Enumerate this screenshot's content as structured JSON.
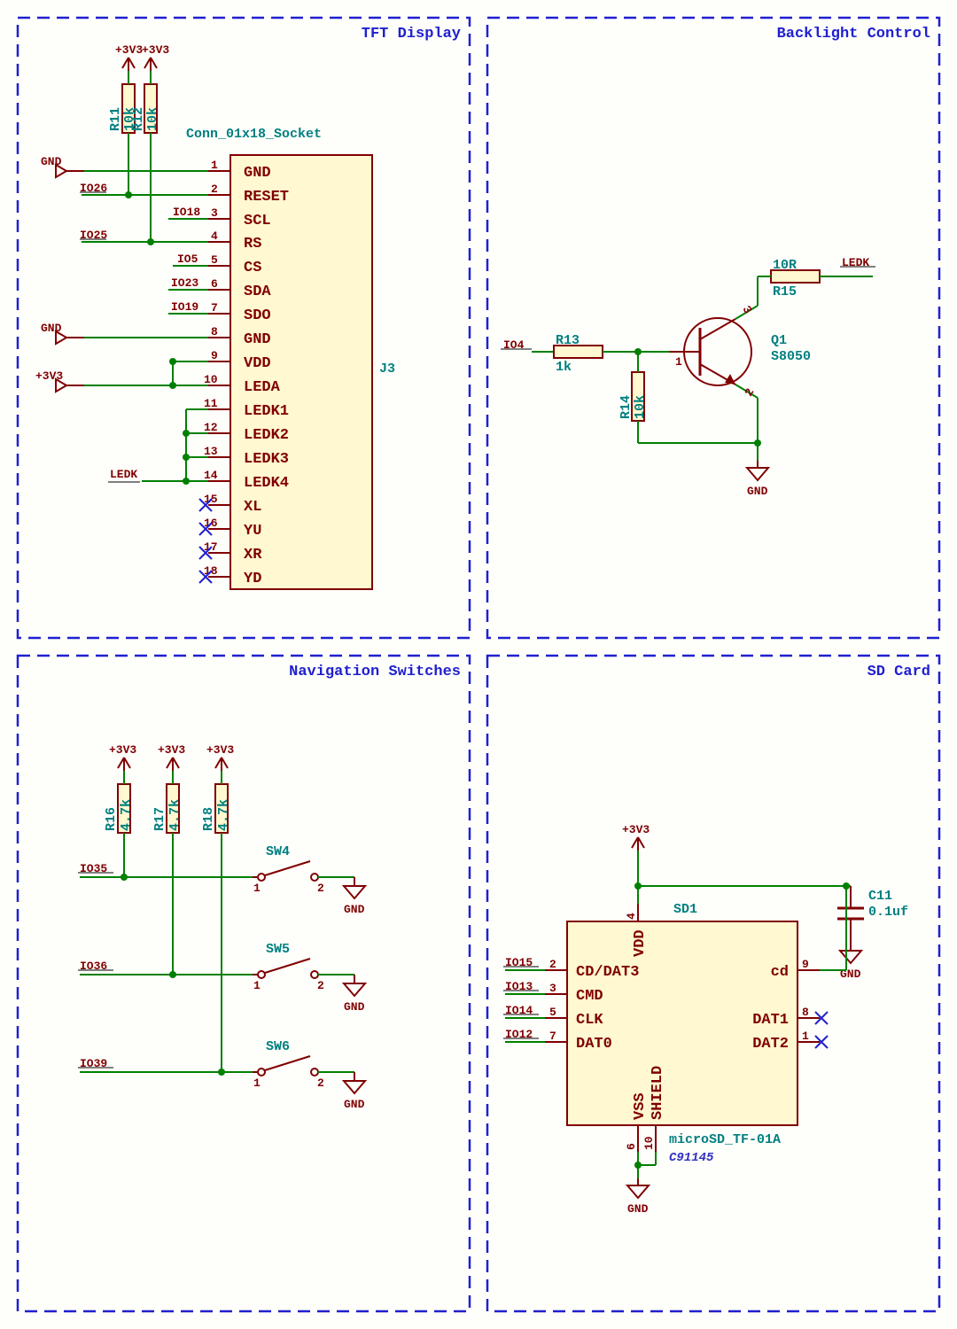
{
  "blocks": {
    "tft": {
      "title": "TFT Display"
    },
    "bl": {
      "title": "Backlight Control"
    },
    "nav": {
      "title": "Navigation Switches"
    },
    "sd": {
      "title": "SD Card"
    }
  },
  "tft": {
    "conn_label": "Conn_01x18_Socket",
    "ref": "J3",
    "r11": {
      "ref": "R11",
      "val": "10k"
    },
    "r12": {
      "ref": "R12",
      "val": "10k"
    },
    "pwr1": "+3V3",
    "pwr2": "+3V3",
    "gnd_top": "GND",
    "gnd_mid": "GND",
    "v33": "+3V3",
    "ledk": "LEDK",
    "nets": {
      "io26": "IO26",
      "io18": "IO18",
      "io25": "IO25",
      "io5": "IO5",
      "io23": "IO23",
      "io19": "IO19"
    },
    "pins": [
      {
        "n": "1",
        "name": "GND"
      },
      {
        "n": "2",
        "name": "RESET"
      },
      {
        "n": "3",
        "name": "SCL"
      },
      {
        "n": "4",
        "name": "RS"
      },
      {
        "n": "5",
        "name": "CS"
      },
      {
        "n": "6",
        "name": "SDA"
      },
      {
        "n": "7",
        "name": "SDO"
      },
      {
        "n": "8",
        "name": "GND"
      },
      {
        "n": "9",
        "name": "VDD"
      },
      {
        "n": "10",
        "name": "LEDA"
      },
      {
        "n": "11",
        "name": "LEDK1"
      },
      {
        "n": "12",
        "name": "LEDK2"
      },
      {
        "n": "13",
        "name": "LEDK3"
      },
      {
        "n": "14",
        "name": "LEDK4"
      },
      {
        "n": "15",
        "name": "XL"
      },
      {
        "n": "16",
        "name": "YU"
      },
      {
        "n": "17",
        "name": "XR"
      },
      {
        "n": "18",
        "name": "YD"
      }
    ]
  },
  "bl": {
    "io4": "IO4",
    "ledk": "LEDK",
    "gnd": "GND",
    "r13": {
      "ref": "R13",
      "val": "1k"
    },
    "r14": {
      "ref": "R14",
      "val": "10k"
    },
    "r15": {
      "ref": "R15",
      "val": "10R"
    },
    "q1": {
      "ref": "Q1",
      "val": "S8050"
    },
    "q1_pins": {
      "b": "1",
      "e": "2",
      "c": "3"
    }
  },
  "nav": {
    "pwr": "+3V3",
    "r16": {
      "ref": "R16",
      "val": "4.7k"
    },
    "r17": {
      "ref": "R17",
      "val": "4.7k"
    },
    "r18": {
      "ref": "R18",
      "val": "4.7k"
    },
    "sw4": {
      "ref": "SW4",
      "p1": "1",
      "p2": "2"
    },
    "sw5": {
      "ref": "SW5",
      "p1": "1",
      "p2": "2"
    },
    "sw6": {
      "ref": "SW6",
      "p1": "1",
      "p2": "2"
    },
    "gnd": "GND",
    "nets": {
      "io35": "IO35",
      "io36": "IO36",
      "io39": "IO39"
    }
  },
  "sd": {
    "pwr": "+3V3",
    "gnd_cap": "GND",
    "gnd_bot": "GND",
    "c11": {
      "ref": "C11",
      "val": "0.1uf"
    },
    "sd1": {
      "ref": "SD1",
      "foot": "microSD_TF-01A",
      "code": "C91145"
    },
    "nets": {
      "io15": "IO15",
      "io13": "IO13",
      "io14": "IO14",
      "io12": "IO12"
    },
    "pins_left": [
      {
        "n": "2",
        "name": "CD/DAT3"
      },
      {
        "n": "3",
        "name": "CMD"
      },
      {
        "n": "5",
        "name": "CLK"
      },
      {
        "n": "7",
        "name": "DAT0"
      }
    ],
    "pins_right": [
      {
        "n": "9",
        "name": "cd"
      },
      {
        "n": "8",
        "name": "DAT1"
      },
      {
        "n": "1",
        "name": "DAT2"
      }
    ],
    "pin_vdd": {
      "n": "4",
      "name": "VDD"
    },
    "pin_vss": {
      "n": "6",
      "name": "VSS"
    },
    "pin_sh": {
      "n": "10",
      "name": "SHIELD"
    }
  }
}
